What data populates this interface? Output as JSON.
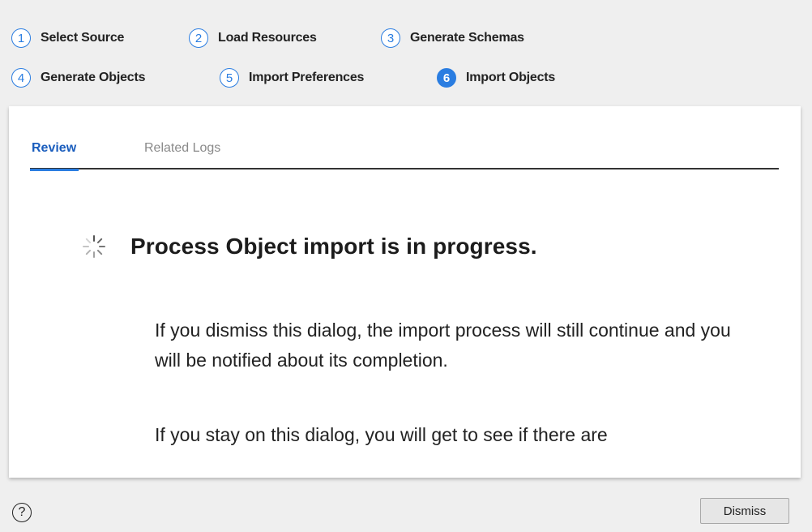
{
  "stepper": {
    "steps": [
      {
        "number": "1",
        "label": "Select Source",
        "state": "inactive"
      },
      {
        "number": "2",
        "label": "Load Resources",
        "state": "inactive"
      },
      {
        "number": "3",
        "label": "Generate Schemas",
        "state": "inactive"
      },
      {
        "number": "4",
        "label": "Generate Objects",
        "state": "inactive"
      },
      {
        "number": "5",
        "label": "Import Preferences",
        "state": "inactive"
      },
      {
        "number": "6",
        "label": "Import Objects",
        "state": "active"
      }
    ]
  },
  "tabs": [
    {
      "label": "Review",
      "selected": true
    },
    {
      "label": "Related Logs",
      "selected": false
    }
  ],
  "status": {
    "icon": "spinner-icon",
    "headline": "Process Object import is in progress.",
    "paragraphs": [
      "If you dismiss this dialog, the import process will still continue and you will be notified about its completion.",
      "If you stay on this dialog, you will get to see if there are"
    ]
  },
  "footer": {
    "help_icon": "?",
    "dismiss_label": "Dismiss"
  },
  "colors": {
    "accent": "#2a7de1",
    "background": "#efefef",
    "panel": "#ffffff"
  }
}
